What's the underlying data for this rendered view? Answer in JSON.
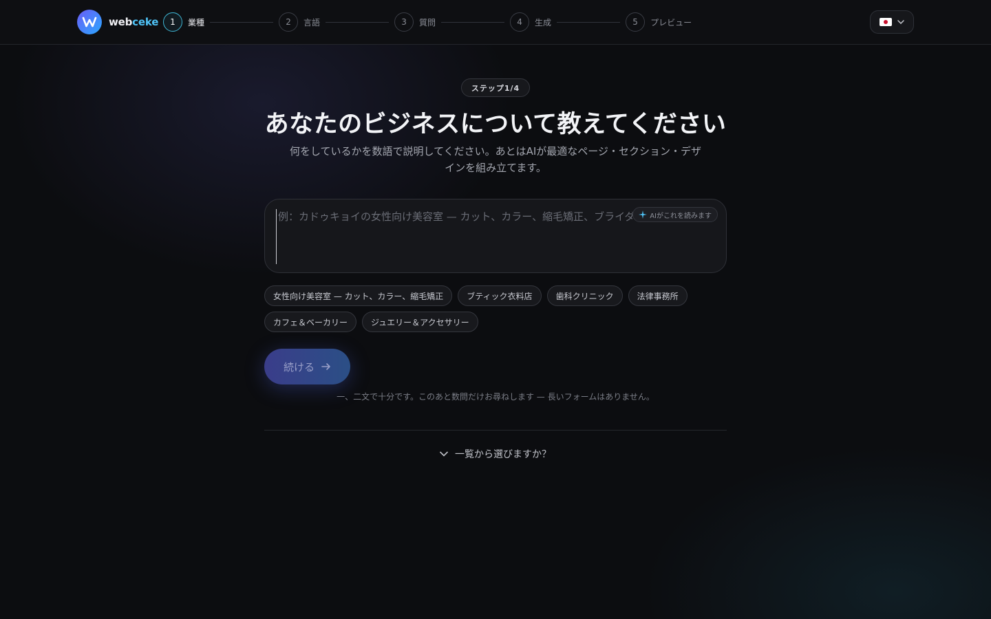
{
  "brand": {
    "name_main": "web",
    "name_accent": "ceke",
    "logo_letter": "W"
  },
  "steps": [
    {
      "number": "1",
      "label": "業種"
    },
    {
      "number": "2",
      "label": "言語"
    },
    {
      "number": "3",
      "label": "質問"
    },
    {
      "number": "4",
      "label": "生成"
    },
    {
      "number": "5",
      "label": "プレビュー"
    }
  ],
  "language": {
    "icon": "japan-flag-icon"
  },
  "badge": "ステップ1/4",
  "title": "あなたのビジネスについて教えてください",
  "subtitle": "何をしているかを数語で説明してください。あとはAIが最適なページ・セクション・デザインを組み立てます。",
  "input": {
    "value": "",
    "placeholder": "例：カドゥキョイの女性向け美容室 — カット、カラー、縮毛矯正、ブライダル",
    "ai_hint": "AIがこれを読みます"
  },
  "chips": [
    "女性向け美容室 — カット、カラー、縮毛矯正",
    "ブティック衣料店",
    "歯科クリニック",
    "法律事務所",
    "カフェ＆ベーカリー",
    "ジュエリー＆アクセサリー"
  ],
  "continue_label": "続ける",
  "hint": "一、二文で十分です。このあと数問だけお尋ねします — 長いフォームはありません。",
  "browse_label": "一覧から選びますか？",
  "colors": {
    "accent": "#3fb8d6",
    "button_start": "#3a3d8a",
    "button_end": "#2b4f86"
  }
}
